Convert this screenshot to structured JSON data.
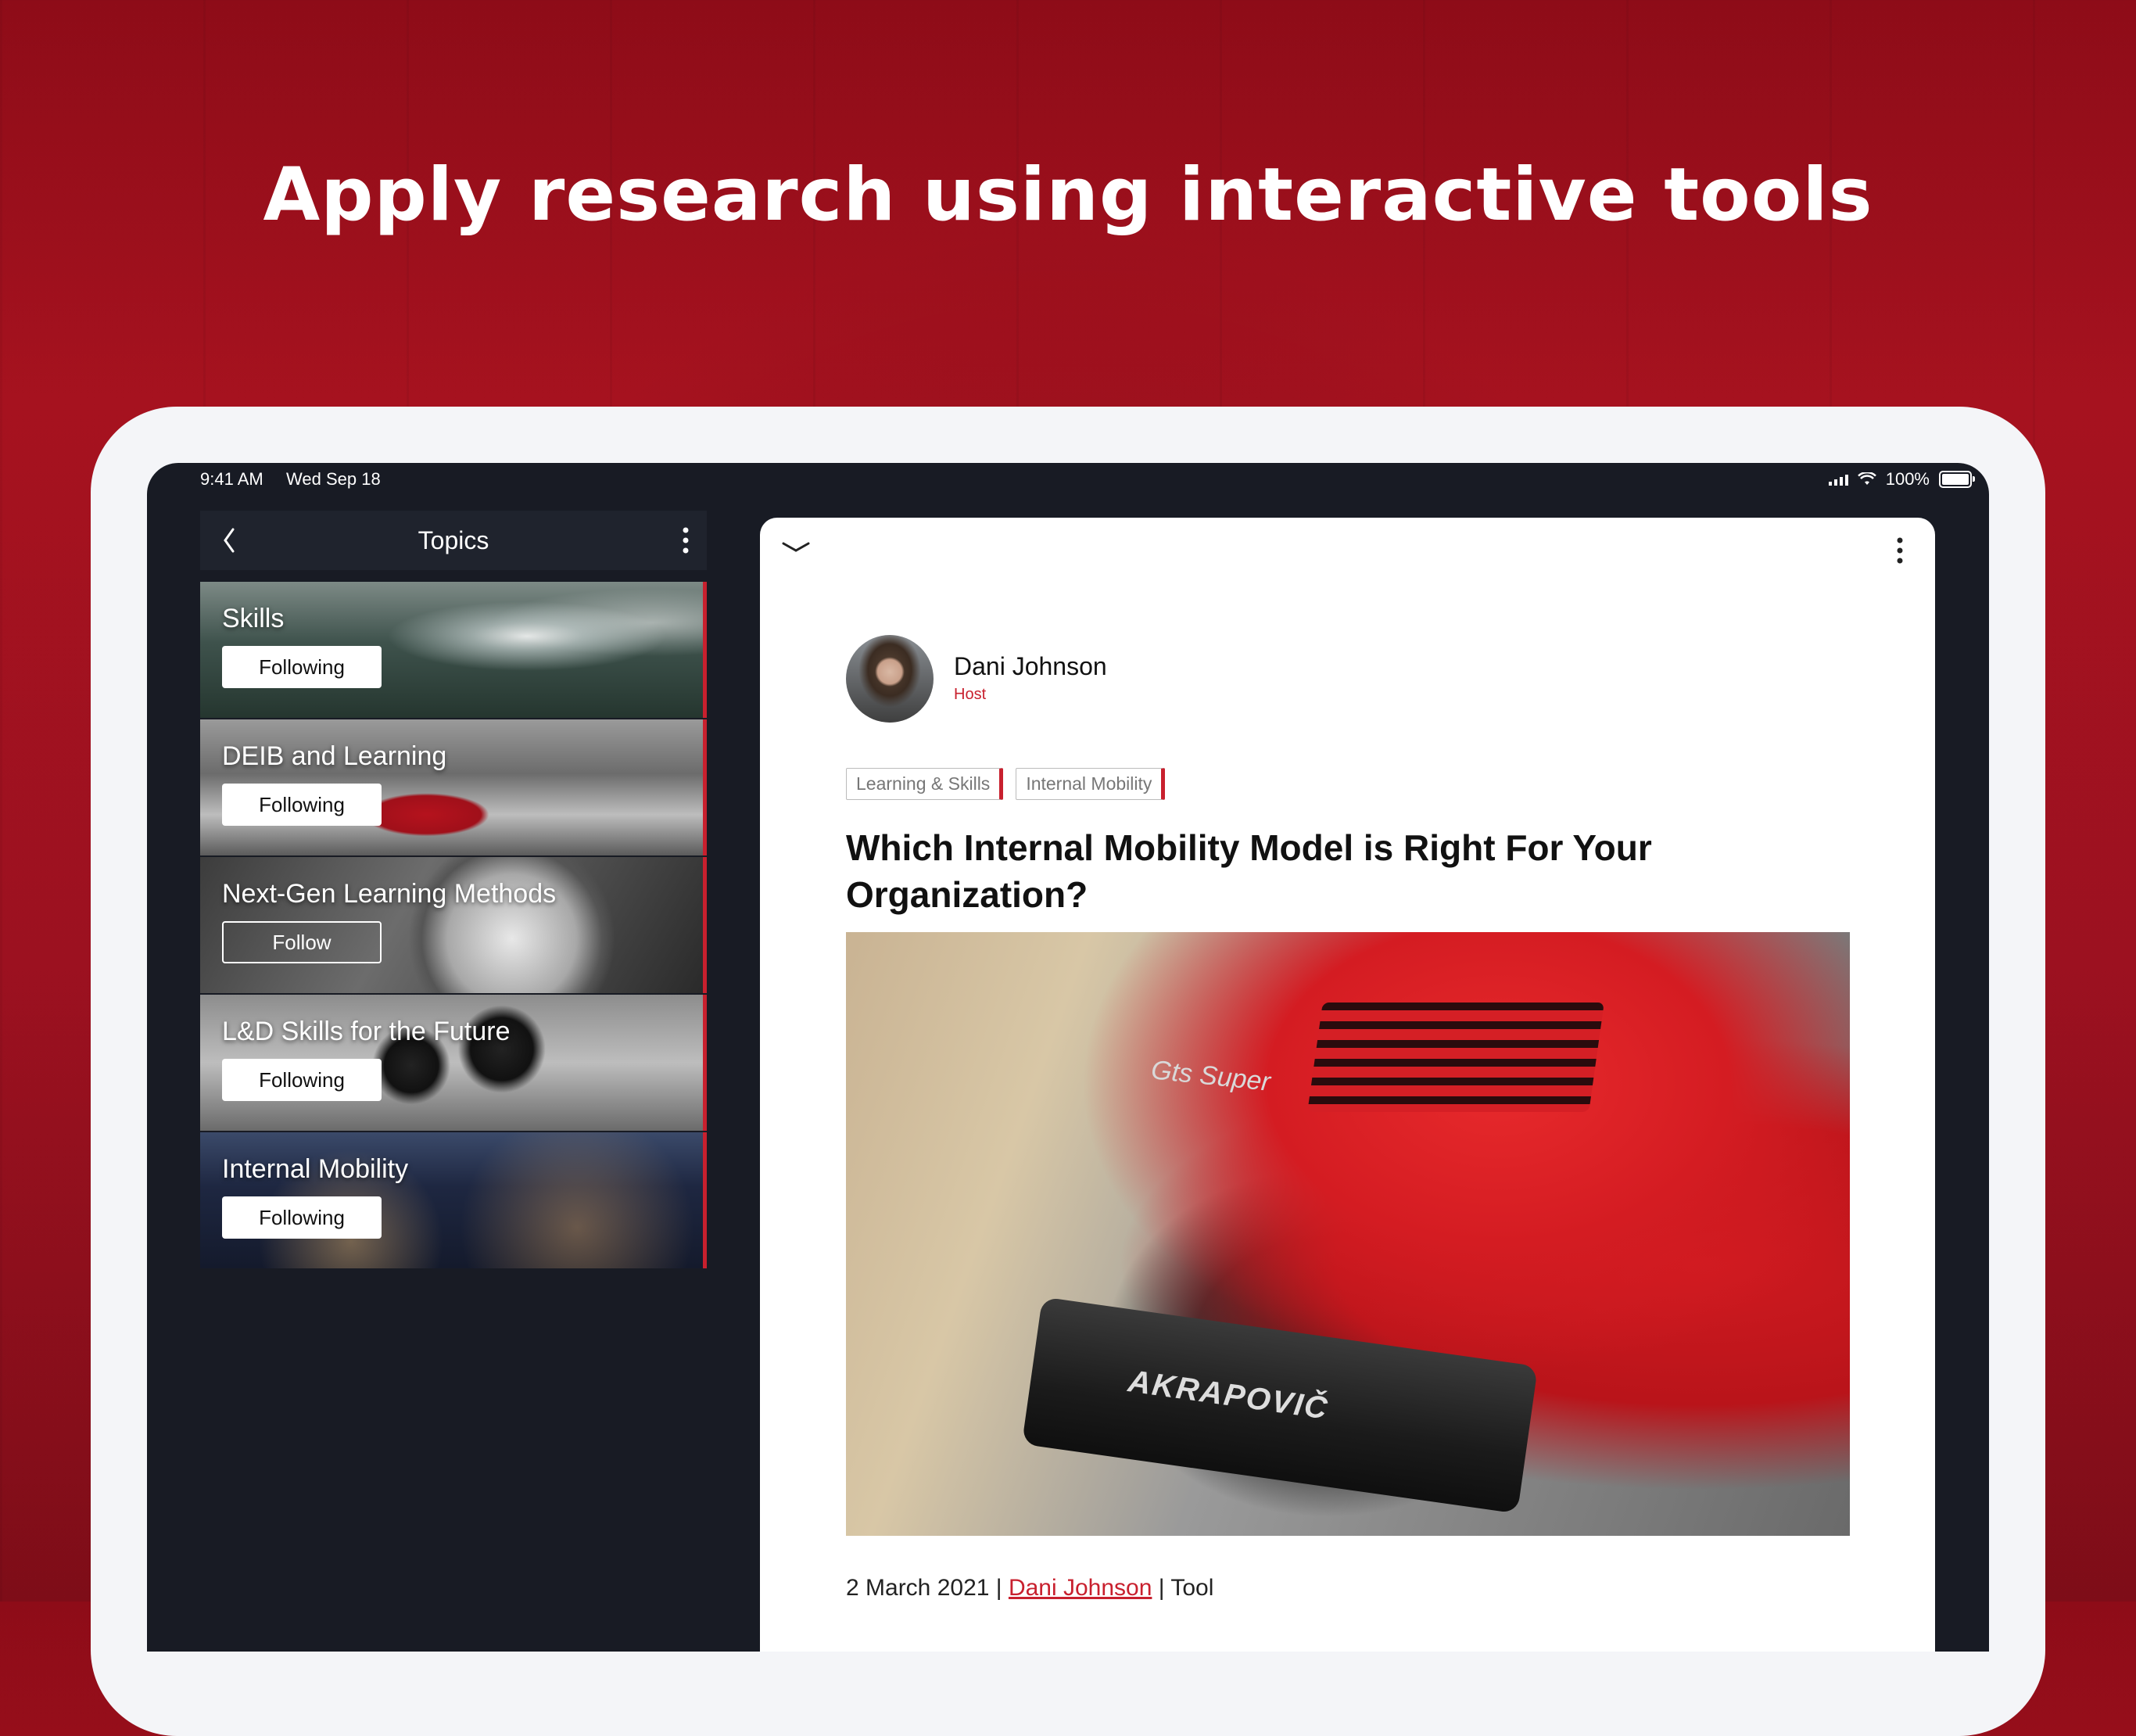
{
  "headline": "Apply research using interactive tools",
  "status": {
    "time": "9:41 AM",
    "date": "Wed Sep 18",
    "battery": "100%"
  },
  "topics": {
    "title": "Topics",
    "items": [
      {
        "name": "Skills",
        "button": "Following"
      },
      {
        "name": "DEIB and Learning",
        "button": "Following"
      },
      {
        "name": "Next-Gen Learning Methods",
        "button": "Follow"
      },
      {
        "name": "L&D Skills for the Future",
        "button": "Following"
      },
      {
        "name": "Internal Mobility",
        "button": "Following"
      }
    ]
  },
  "article": {
    "author": {
      "name": "Dani Johnson",
      "role": "Host"
    },
    "tags": [
      "Learning & Skills",
      "Internal Mobility"
    ],
    "title": "Which Internal Mobility Model is Right For Your Organization?",
    "image_texts": {
      "badge": "Gts Super",
      "muffler": "AKRAPOVIČ"
    },
    "meta": {
      "date": "2 March 2021",
      "separator": "|",
      "author": "Dani Johnson",
      "type": "Tool"
    }
  },
  "colors": {
    "accent": "#c8202e",
    "background": "#9c1120",
    "panel": "#181b24"
  }
}
